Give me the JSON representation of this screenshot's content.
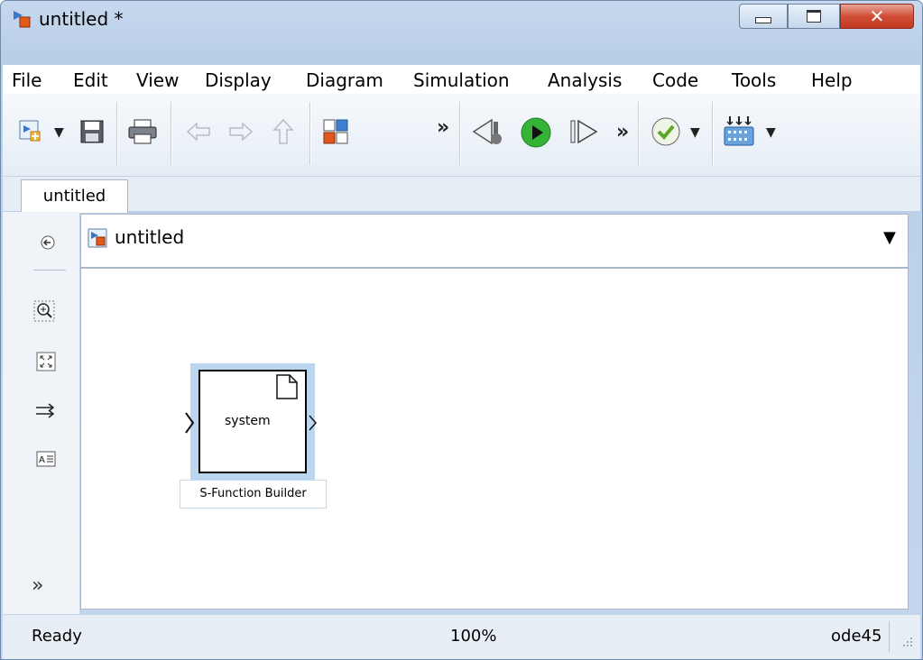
{
  "window": {
    "title": "untitled *",
    "controls": {
      "minimize": "minimize-icon",
      "maximize": "maximize-icon",
      "close": "close-icon"
    }
  },
  "menu": [
    {
      "label": "File"
    },
    {
      "label": "Edit"
    },
    {
      "label": "View"
    },
    {
      "label": "Display"
    },
    {
      "label": "Diagram"
    },
    {
      "label": "Simulation"
    },
    {
      "label": "Analysis"
    },
    {
      "label": "Code"
    },
    {
      "label": "Tools"
    },
    {
      "label": "Help"
    }
  ],
  "toolbar": {
    "more_glyph_1": "»",
    "more_glyph_2": "»",
    "dropdown_glyph": "▼"
  },
  "tabs": [
    {
      "label": "untitled"
    }
  ],
  "address": {
    "model": "untitled"
  },
  "palette": {
    "more_glyph": "»"
  },
  "canvas": {
    "block": {
      "text": "system",
      "label": "S-Function Builder"
    }
  },
  "status": {
    "state": "Ready",
    "zoom": "100%",
    "solver": "ode45"
  }
}
